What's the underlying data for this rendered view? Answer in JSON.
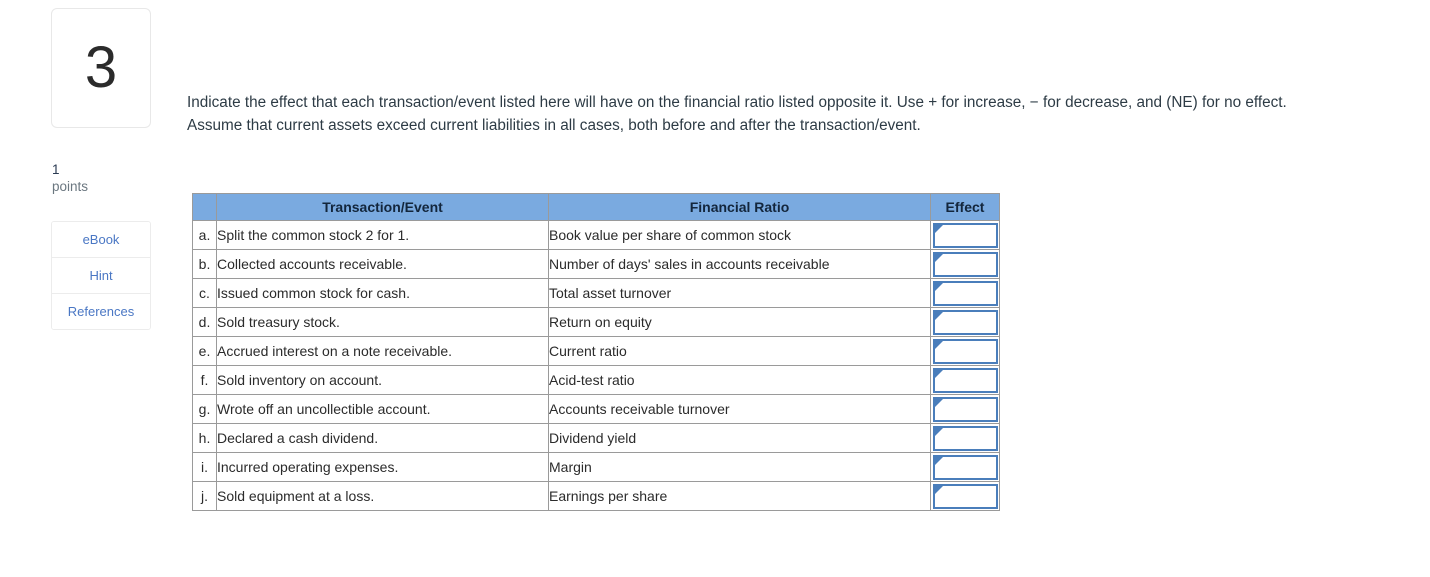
{
  "question": {
    "number": "3",
    "points_value": "1",
    "points_label": "points",
    "prompt": "Indicate the effect that each transaction/event listed here will have on the financial ratio listed opposite it. Use + for increase, − for decrease, and (NE) for no effect. Assume that current assets exceed current liabilities in all cases, both before and after the transaction/event."
  },
  "resources": {
    "ebook_label": "eBook",
    "hint_label": "Hint",
    "references_label": "References"
  },
  "table": {
    "headers": {
      "letter": "",
      "transaction": "Transaction/Event",
      "ratio": "Financial Ratio",
      "effect": "Effect"
    },
    "rows": [
      {
        "letter": "a.",
        "transaction": "Split the common stock 2 for 1.",
        "ratio": "Book value per share of common stock",
        "effect": ""
      },
      {
        "letter": "b.",
        "transaction": "Collected accounts receivable.",
        "ratio": "Number of days' sales in accounts receivable",
        "effect": ""
      },
      {
        "letter": "c.",
        "transaction": "Issued common stock for cash.",
        "ratio": "Total asset turnover",
        "effect": ""
      },
      {
        "letter": "d.",
        "transaction": "Sold treasury stock.",
        "ratio": "Return on equity",
        "effect": ""
      },
      {
        "letter": "e.",
        "transaction": "Accrued interest on a note receivable.",
        "ratio": "Current ratio",
        "effect": ""
      },
      {
        "letter": "f.",
        "transaction": "Sold inventory on account.",
        "ratio": "Acid-test ratio",
        "effect": ""
      },
      {
        "letter": "g.",
        "transaction": "Wrote off an uncollectible account.",
        "ratio": "Accounts receivable turnover",
        "effect": ""
      },
      {
        "letter": "h.",
        "transaction": "Declared a cash dividend.",
        "ratio": "Dividend yield",
        "effect": ""
      },
      {
        "letter": "i.",
        "transaction": "Incurred operating expenses.",
        "ratio": "Margin",
        "effect": ""
      },
      {
        "letter": "j.",
        "transaction": "Sold equipment at a loss.",
        "ratio": "Earnings per share",
        "effect": ""
      }
    ]
  },
  "colors": {
    "header_blue": "#7aaae0",
    "input_border_blue": "#4a7ebb",
    "link_blue": "#4a77c4",
    "text_dark": "#2d3b45"
  }
}
